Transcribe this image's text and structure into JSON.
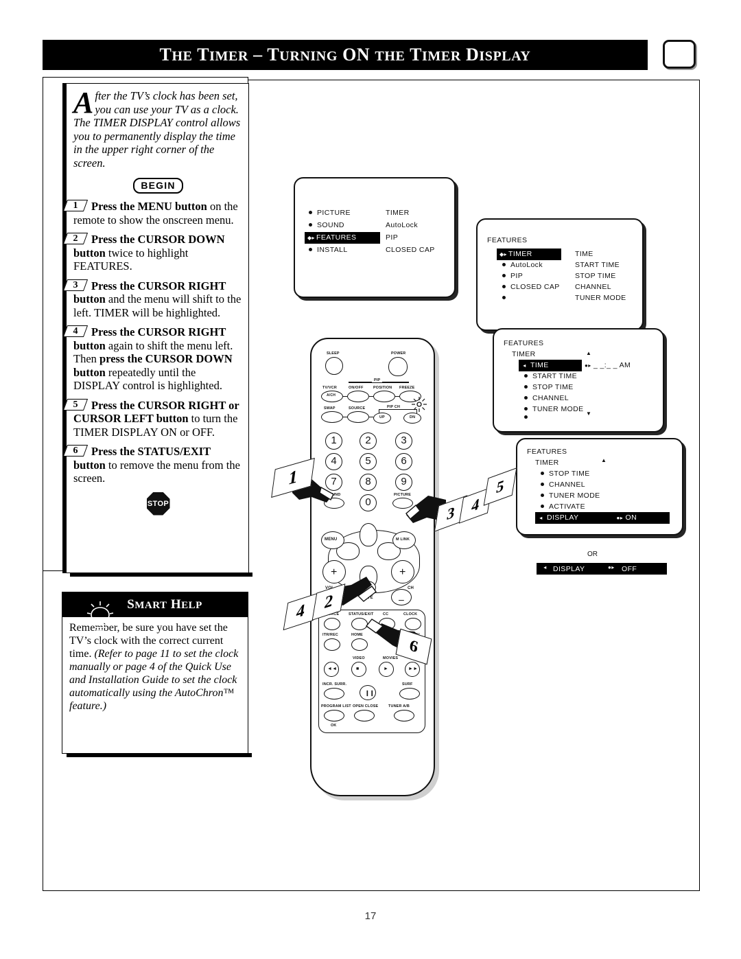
{
  "header": {
    "title": "The Timer – Turning ON the Timer Display",
    "tv_icon": "tv-icon"
  },
  "intro": {
    "dropcap": "A",
    "line1": "fter the TV’s clock has been set,",
    "line2": "you can use your TV as a clock.",
    "rest": "The TIMER DISPLAY control allows you to permanently display the time in the upper right corner of the screen."
  },
  "begin_label": "BEGIN",
  "stop_label": "STOP",
  "steps": [
    {
      "num": "1",
      "bold1": "Press the MENU button",
      "rest": " on the remote to show the onscreen menu."
    },
    {
      "num": "2",
      "bold1": "Press the CURSOR DOWN button",
      "rest": " twice to highlight FEATURES."
    },
    {
      "num": "3",
      "bold1": "Press the CURSOR RIGHT button",
      "rest": " and the menu will shift to the left. TIMER will be highlighted."
    },
    {
      "num": "4",
      "bold1": "Press the CURSOR RIGHT button",
      "mid": " again to shift the menu left. Then ",
      "bold2": "press the CURSOR DOWN button",
      "rest": " repeatedly until the DISPLAY control is highlighted."
    },
    {
      "num": "5",
      "bold1": "Press the CURSOR RIGHT or CURSOR LEFT button",
      "rest": " to turn the TIMER DISPLAY ON or OFF."
    },
    {
      "num": "6",
      "bold1": "Press the STATUS/EXIT button",
      "rest": " to remove the menu from the screen."
    }
  ],
  "smart_help": {
    "title": "Smart Help",
    "plain": "Remember, be sure you have set the TV’s clock with the correct current time. ",
    "italic": "(Refer to page 11 to set the clock manually or page 4 of the Quick Use and Installation Guide to set the clock automatically using the AutoChron™ feature.)"
  },
  "screens": {
    "screen1": {
      "left_items": [
        "PICTURE",
        "SOUND",
        "FEATURES",
        "INSTALL"
      ],
      "highlighted": "FEATURES",
      "right_items": [
        "TIMER",
        "AutoLock",
        "PIP",
        "CLOSED  CAP"
      ]
    },
    "screen2": {
      "header": "FEATURES",
      "left_items": [
        "TIMER",
        "AutoLock",
        "PIP",
        "CLOSED  CAP",
        ""
      ],
      "highlighted": "TIMER",
      "right_items": [
        "TIME",
        "START  TIME",
        "STOP  TIME",
        "CHANNEL",
        "TUNER  MODE"
      ]
    },
    "screen3": {
      "header": "FEATURES",
      "subheader": "TIMER",
      "items": [
        "TIME",
        "START  TIME",
        "STOP  TIME",
        "CHANNEL",
        "TUNER  MODE",
        ""
      ],
      "highlighted": "TIME",
      "value": "_  _:_  _  AM",
      "up_arrow": "▲",
      "down_arrow": "▼"
    },
    "screen4": {
      "header": "FEATURES",
      "subheader": "TIMER",
      "items": [
        "STOP  TIME",
        "CHANNEL",
        "TUNER  MODE",
        "ACTIVATE",
        "DISPLAY"
      ],
      "highlighted": "DISPLAY",
      "highlighted_value": "ON"
    },
    "or_label": "OR",
    "display_off": {
      "label": "DISPLAY",
      "value": "OFF"
    }
  },
  "remote": {
    "top_labels": [
      "SLEEP",
      "POWER",
      "PIP"
    ],
    "row1": [
      "TV/VCR",
      "ON/OFF",
      "POSITION",
      "FREEZE"
    ],
    "row1_inner": "A/CH",
    "row2": [
      "SWAP",
      "SOURCE",
      "PIP CH"
    ],
    "row2_inner": [
      "UP",
      "DN"
    ],
    "numbers": [
      "1",
      "2",
      "3",
      "4",
      "5",
      "6",
      "7",
      "8",
      "9",
      "0"
    ],
    "sound_label": "SOUND",
    "picture_label": "PICTURE",
    "menu_label": "MENU",
    "mlink_label": "M LINK",
    "vol_label": "VOL",
    "ch_label": "CH",
    "mute_label": "MUTE",
    "plus": "+",
    "minus": "–",
    "fn_row1": [
      "SOURCE",
      "STATUS/EXIT",
      "CC",
      "CLOCK"
    ],
    "fn_row2": [
      "ITR/REC",
      "HOME",
      "PERSONAL"
    ],
    "fn_row3": [
      "VIDEO",
      "MOVIES"
    ],
    "transport": [
      "◄◄",
      "■",
      "►",
      "►►"
    ],
    "fn_row4": [
      "INCR. SURR.",
      "SURF"
    ],
    "pause": "❙❙",
    "fn_row5": [
      "PROGRAM LIST",
      "OPEN CLOSE",
      "TUNER A/B"
    ],
    "ok_label": "OK"
  },
  "callouts": [
    "1",
    "2",
    "3",
    "4",
    "5",
    "6"
  ],
  "page_number": "17"
}
